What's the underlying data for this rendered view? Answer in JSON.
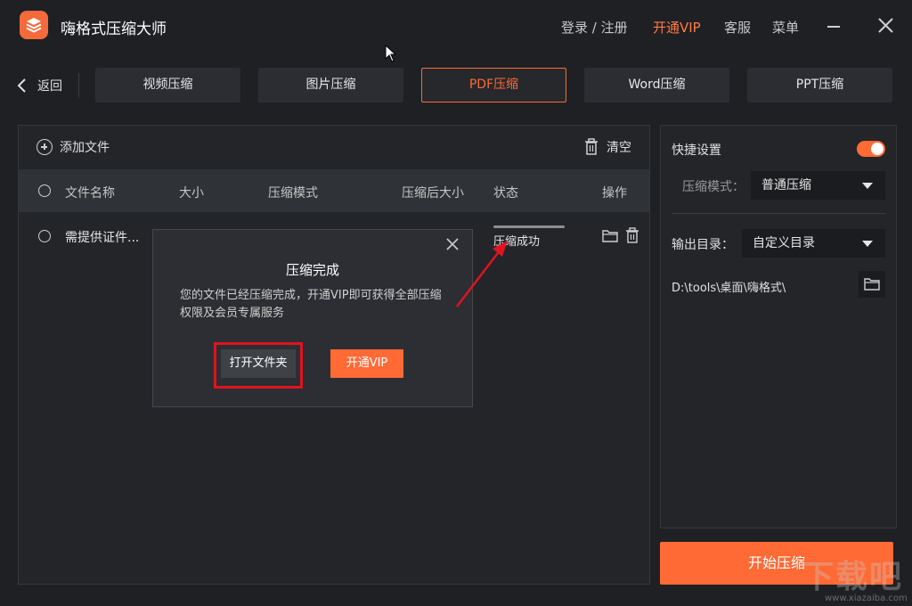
{
  "app": {
    "title": "嗨格式压缩大师"
  },
  "top_menu": {
    "login": "登录 / 注册",
    "vip": "开通VIP",
    "service": "客服",
    "menu": "菜单"
  },
  "toolbar": {
    "back_label": "返回",
    "tabs": [
      {
        "label": "视频压缩",
        "active": false
      },
      {
        "label": "图片压缩",
        "active": false
      },
      {
        "label": "PDF压缩",
        "active": true
      },
      {
        "label": "Word压缩",
        "active": false
      },
      {
        "label": "PPT压缩",
        "active": false
      }
    ]
  },
  "file_panel": {
    "add_file": "添加文件",
    "clear": "清空",
    "columns": [
      "文件名称",
      "大小",
      "压缩模式",
      "压缩后大小",
      "状态",
      "操作"
    ],
    "rows": [
      {
        "name": "需提供证件...",
        "status": "压缩成功"
      }
    ]
  },
  "modal": {
    "title": "压缩完成",
    "message": "您的文件已经压缩完成，开通VIP即可获得全部压缩权限及会员专属服务",
    "open_folder": "打开文件夹",
    "vip_button": "开通VIP"
  },
  "settings": {
    "quick_settings": "快捷设置",
    "quick_enabled": true,
    "mode_label": "压缩模式：",
    "mode_value": "普通压缩",
    "output_label": "输出目录：",
    "output_value": "自定义目录",
    "output_path": "D:\\tools\\桌面\\嗨格式\\"
  },
  "start_button": "开始压缩",
  "watermark": {
    "text": "下载吧",
    "url": "www.xiazaiba.com"
  },
  "colors": {
    "accent": "#ff6a35",
    "background": "#1e2024",
    "panel": "#232529",
    "highlight": "#e0141e"
  }
}
